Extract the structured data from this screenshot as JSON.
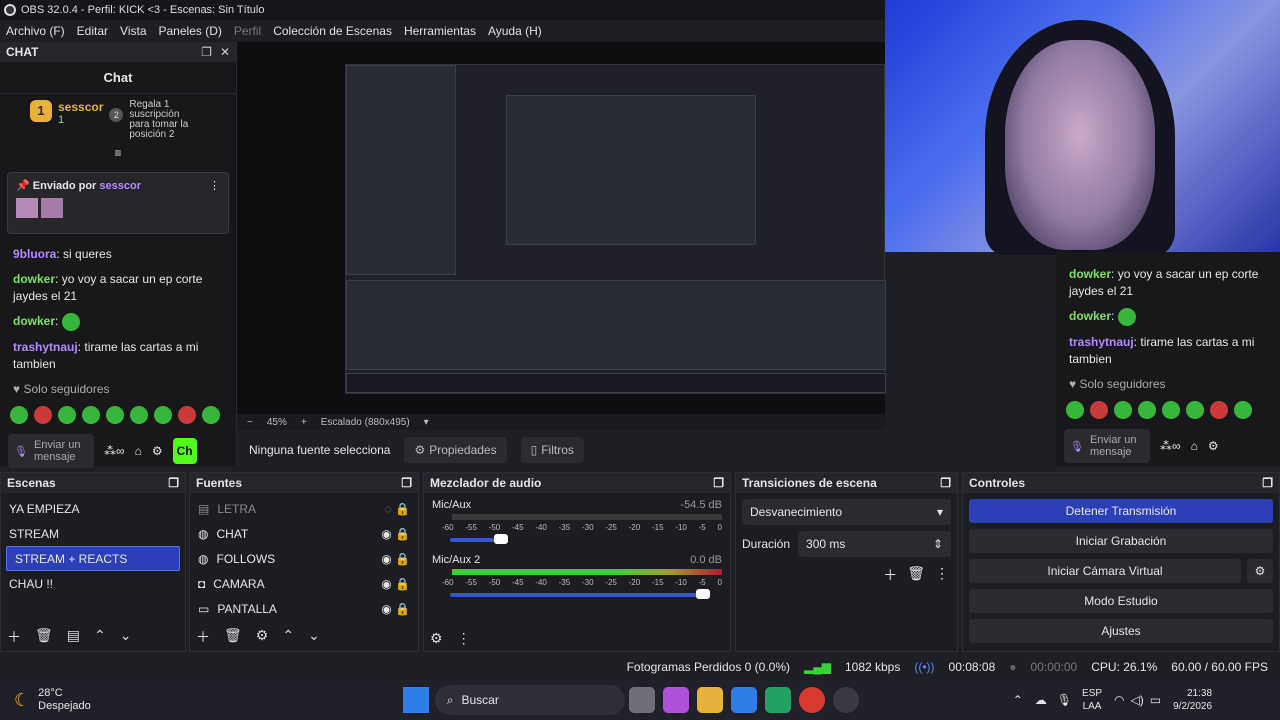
{
  "window_title": "OBS 32.0.4 - Perfil: KICK <3 - Escenas: Sin Título",
  "menu": [
    "Archivo (F)",
    "Editar",
    "Vista",
    "Paneles (D)",
    "Perfil",
    "Colección de Escenas",
    "Herramientas",
    "Ayuda (H)"
  ],
  "chat": {
    "dock_title": "CHAT",
    "title": "Chat",
    "leader_name": "sesscor",
    "leader_rank": "1",
    "leader_count": "1",
    "gift_rank": "2",
    "gift_text": "Regala 1 suscripción para tomar la posición 2",
    "pinned_label": "Enviado por",
    "pinned_user": "sesscor",
    "messages": [
      {
        "user": "9bluora",
        "text": "si queres"
      },
      {
        "user": "dowker",
        "text": "yo voy a sacar un ep corte jaydes el 21"
      },
      {
        "user": "dowker",
        "text": ""
      },
      {
        "user": "trashytnauj",
        "text": "tirame las cartas a mi tambien"
      }
    ],
    "followers_only": "Solo seguidores",
    "input_placeholder": "Enviar un mensaje",
    "send_label": "Ch"
  },
  "right_chat": {
    "messages": [
      {
        "user": "dowker",
        "text": "yo voy a sacar un ep corte jaydes el 21"
      },
      {
        "user": "dowker",
        "text": ""
      },
      {
        "user": "trashytnauj",
        "text": "tirame las cartas a mi tambien"
      }
    ],
    "followers_only": "Solo seguidores",
    "input_placeholder": "Enviar un mensaje"
  },
  "preview": {
    "zoom": "45%",
    "scale": "Escalado (880x495)"
  },
  "source_bar": {
    "none_selected": "Ninguna fuente selecciona",
    "properties": "Propiedades",
    "filters": "Filtros"
  },
  "scenes": {
    "title": "Escenas",
    "items": [
      "YA EMPIEZA",
      "STREAM",
      "STREAM + REACTS",
      "CHAU !!"
    ],
    "selected": "STREAM + REACTS"
  },
  "sources": {
    "title": "Fuentes",
    "items": [
      "LETRA",
      "CHAT",
      "FOLLOWS",
      "CAMARA",
      "PANTALLA"
    ]
  },
  "mixer": {
    "title": "Mezclador de audio",
    "ch1": {
      "name": "Mic/Aux",
      "db": "-54.5 dB",
      "level": 0.0
    },
    "ch2": {
      "name": "Mic/Aux 2",
      "db": "0.0 dB",
      "level": 1.0
    },
    "scale": [
      "-60",
      "-55",
      "-50",
      "-45",
      "-40",
      "-35",
      "-30",
      "-25",
      "-20",
      "-15",
      "-10",
      "-5",
      "0"
    ]
  },
  "transitions": {
    "title": "Transiciones de escena",
    "type": "Desvanecimiento",
    "duration_label": "Duración",
    "duration": "300 ms"
  },
  "controls": {
    "title": "Controles",
    "stop": "Detener Transmisión",
    "record": "Iniciar Grabación",
    "vcam": "Iniciar Cámara Virtual",
    "studio": "Modo Estudio",
    "settings": "Ajustes"
  },
  "status": {
    "dropped": "Fotogramas Perdidos 0 (0.0%)",
    "bitrate": "1082 kbps",
    "stream_time": "00:08:08",
    "rec_time": "00:00:00",
    "cpu": "CPU: 26.1%",
    "fps": "60.00 / 60.00 FPS"
  },
  "taskbar": {
    "temp": "28°C",
    "weather": "Despejado",
    "search": "Buscar",
    "lang1": "ESP",
    "lang2": "LAA",
    "time": "21:38",
    "date": "9/2/2026"
  }
}
